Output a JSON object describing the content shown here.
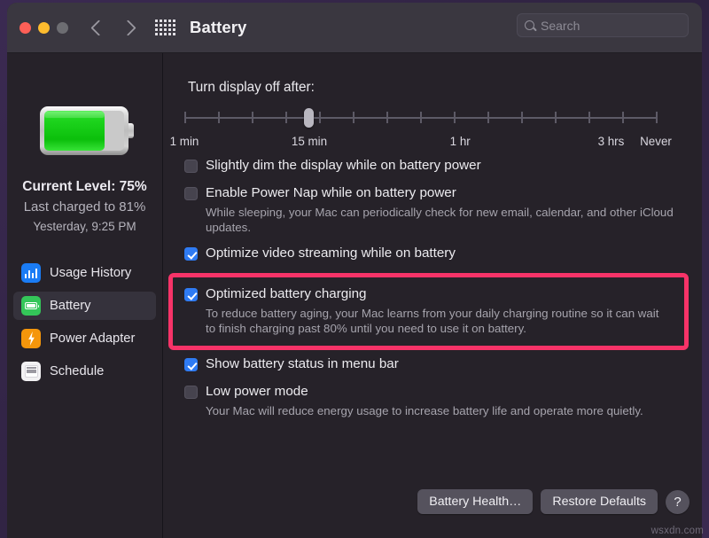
{
  "window": {
    "title": "Battery",
    "traffic_lights": [
      "close",
      "minimize",
      "zoom"
    ]
  },
  "toolbar": {
    "back_icon": "chevron-left-icon",
    "forward_icon": "chevron-right-icon",
    "grid_icon": "grid-apps-icon",
    "search": {
      "placeholder": "Search",
      "value": "",
      "icon": "search-icon"
    }
  },
  "sidebar": {
    "battery_graphic": {
      "icon": "battery-illustration",
      "fill_percent": 75,
      "fill_color": "#1fd11f"
    },
    "current_level": "Current Level: 75%",
    "last_charged": "Last charged to 81%",
    "last_charged_when": "Yesterday, 9:25 PM",
    "items": [
      {
        "label": "Usage History",
        "icon": "usage-history-icon",
        "color": "#1a7cf5",
        "selected": false
      },
      {
        "label": "Battery",
        "icon": "battery-icon",
        "color": "#34c659",
        "selected": true
      },
      {
        "label": "Power Adapter",
        "icon": "power-adapter-icon",
        "color": "#f5960b",
        "selected": false
      },
      {
        "label": "Schedule",
        "icon": "schedule-icon",
        "color": "#f2f1f3",
        "selected": false
      }
    ]
  },
  "main": {
    "slider": {
      "label": "Turn display off after:",
      "value": "15 min",
      "tick_count": 15,
      "knob_position_percent": 26.5,
      "legend": [
        {
          "text": "1 min",
          "position_percent": 0
        },
        {
          "text": "15 min",
          "position_percent": 26.5
        },
        {
          "text": "1 hr",
          "position_percent": 58.5
        },
        {
          "text": "3 hrs",
          "position_percent": 90.5
        },
        {
          "text": "Never",
          "position_percent": 100
        }
      ]
    },
    "options": [
      {
        "label": "Slightly dim the display while on battery power",
        "checked": false,
        "description": ""
      },
      {
        "label": "Enable Power Nap while on battery power",
        "checked": false,
        "description": "While sleeping, your Mac can periodically check for new email, calendar, and other iCloud updates."
      },
      {
        "label": "Optimize video streaming while on battery",
        "checked": true,
        "description": ""
      }
    ],
    "highlighted_option": {
      "label": "Optimized battery charging",
      "checked": true,
      "description": "To reduce battery aging, your Mac learns from your daily charging routine so it can wait to finish charging past 80% until you need to use it on battery.",
      "highlight_color": "#f73368"
    },
    "options_after": [
      {
        "label": "Show battery status in menu bar",
        "checked": true,
        "description": ""
      },
      {
        "label": "Low power mode",
        "checked": false,
        "description": "Your Mac will reduce energy usage to increase battery life and operate more quietly."
      }
    ],
    "footer": {
      "battery_health_label": "Battery Health…",
      "restore_defaults_label": "Restore Defaults",
      "help_label": "?"
    }
  },
  "watermark": "wsxdn.com"
}
